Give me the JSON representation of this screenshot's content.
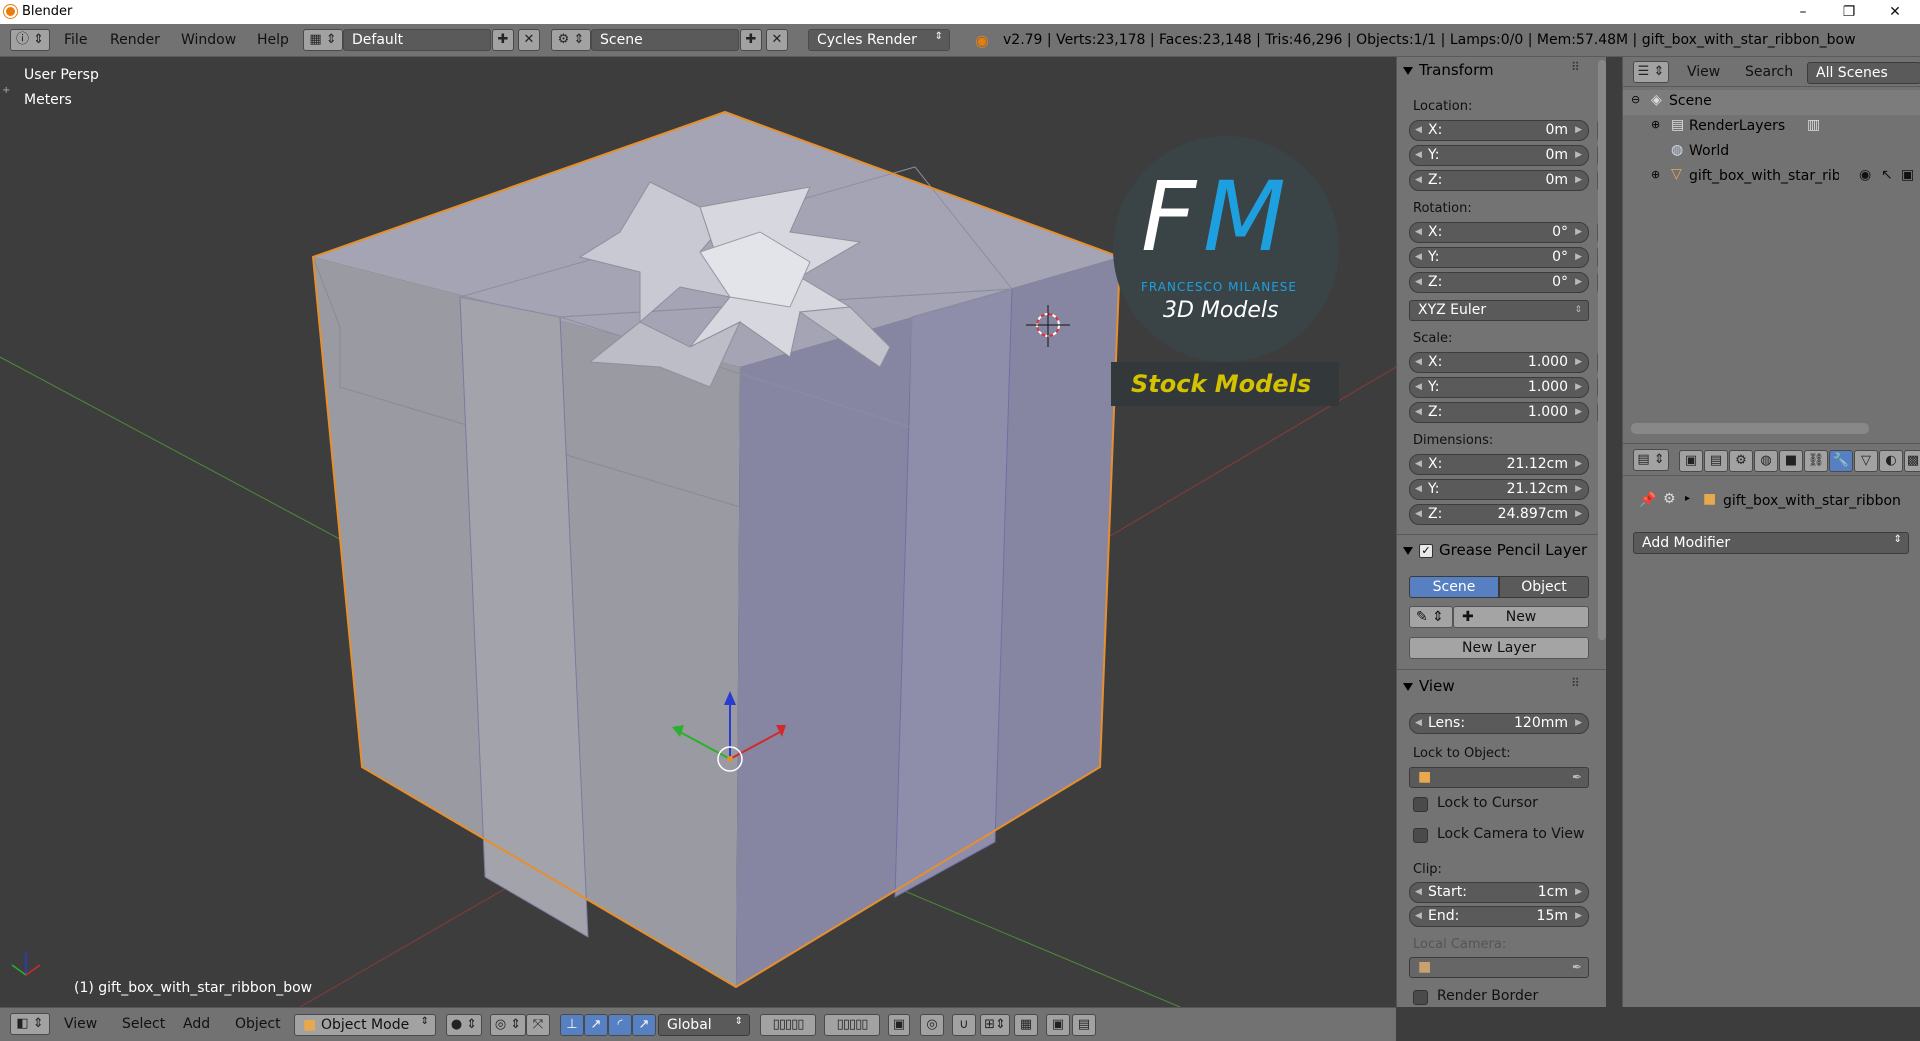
{
  "window": {
    "title": "Blender",
    "minimize": "–",
    "maximize": "❐",
    "close": "✕"
  },
  "infobar": {
    "menus": [
      "File",
      "Render",
      "Window",
      "Help"
    ],
    "layout": "Default",
    "scene": "Scene",
    "engine": "Cycles Render",
    "stats": "v2.79 | Verts:23,178 | Faces:23,148 | Tris:46,296 | Objects:1/1 | Lamps:0/0 | Mem:57.48M | gift_box_with_star_ribbon_bow"
  },
  "viewport": {
    "view_name": "User Persp",
    "units": "Meters",
    "object_label": "(1) gift_box_with_star_ribbon_bow",
    "watermark": {
      "initial_f": "F",
      "initial_m": "M",
      "name": "FRANCESCO MILANESE",
      "line": "3D Models",
      "banner": "Stock Models"
    }
  },
  "transform": {
    "header": "Transform",
    "location_label": "Location:",
    "location": [
      {
        "axis": "X:",
        "value": "0m"
      },
      {
        "axis": "Y:",
        "value": "0m"
      },
      {
        "axis": "Z:",
        "value": "0m"
      }
    ],
    "rotation_label": "Rotation:",
    "rotation": [
      {
        "axis": "X:",
        "value": "0°"
      },
      {
        "axis": "Y:",
        "value": "0°"
      },
      {
        "axis": "Z:",
        "value": "0°"
      }
    ],
    "rotation_mode": "XYZ Euler",
    "scale_label": "Scale:",
    "scale": [
      {
        "axis": "X:",
        "value": "1.000"
      },
      {
        "axis": "Y:",
        "value": "1.000"
      },
      {
        "axis": "Z:",
        "value": "1.000"
      }
    ],
    "dimensions_label": "Dimensions:",
    "dimensions": [
      {
        "axis": "X:",
        "value": "21.12cm"
      },
      {
        "axis": "Y:",
        "value": "21.12cm"
      },
      {
        "axis": "Z:",
        "value": "24.897cm"
      }
    ]
  },
  "grease_pencil": {
    "header": "Grease Pencil Layer",
    "tab_scene": "Scene",
    "tab_object": "Object",
    "new_label": "New",
    "new_layer_label": "New Layer"
  },
  "view_panel": {
    "header": "View",
    "lens_label": "Lens:",
    "lens_value": "120mm",
    "lock_object_label": "Lock to Object:",
    "lock_cursor": "Lock to Cursor",
    "lock_camera": "Lock Camera to View",
    "clip_label": "Clip:",
    "clip_start_label": "Start:",
    "clip_start_value": "1cm",
    "clip_end_label": "End:",
    "clip_end_value": "15m",
    "local_camera_label": "Local Camera:",
    "render_border": "Render Border"
  },
  "outliner": {
    "view_menu": "View",
    "search_menu": "Search",
    "filter": "All Scenes",
    "items": [
      {
        "label": "Scene",
        "icon": "scene-icon"
      },
      {
        "label": "RenderLayers",
        "icon": "render-layers-icon"
      },
      {
        "label": "World",
        "icon": "world-icon"
      },
      {
        "label": "gift_box_with_star_ribb",
        "icon": "mesh-icon"
      }
    ]
  },
  "properties": {
    "object_name": "gift_box_with_star_ribbon",
    "add_modifier": "Add Modifier"
  },
  "bottombar": {
    "menus": [
      "View",
      "Select",
      "Add",
      "Object"
    ],
    "mode": "Object Mode",
    "orientation": "Global"
  },
  "colors": {
    "panel": "#727272",
    "viewport": "#3d3d3d",
    "active_blue": "#5680c2",
    "selection_orange": "#e58f2e",
    "logo_blue": "#1ea0e0",
    "banner_yellow": "#d4c200"
  }
}
